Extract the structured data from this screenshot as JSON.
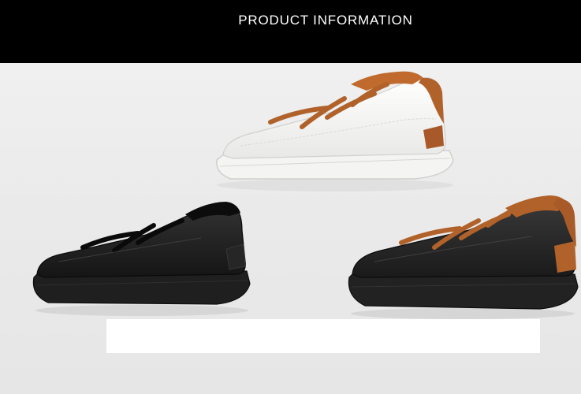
{
  "header": {
    "title": "PRODUCT INFORMATION"
  },
  "colors": {
    "header_bg": "#000000",
    "background": "#efefef",
    "accent_brown": "#b0622a",
    "leather_black": "#1c1c1c",
    "leather_white": "#f7f7f5"
  },
  "products": [
    {
      "variant": "white-with-brown-accents",
      "icon": "white-sneaker-image"
    },
    {
      "variant": "all-black",
      "icon": "black-sneaker-image"
    },
    {
      "variant": "black-with-brown-accents",
      "icon": "black-brown-sneaker-image"
    }
  ]
}
